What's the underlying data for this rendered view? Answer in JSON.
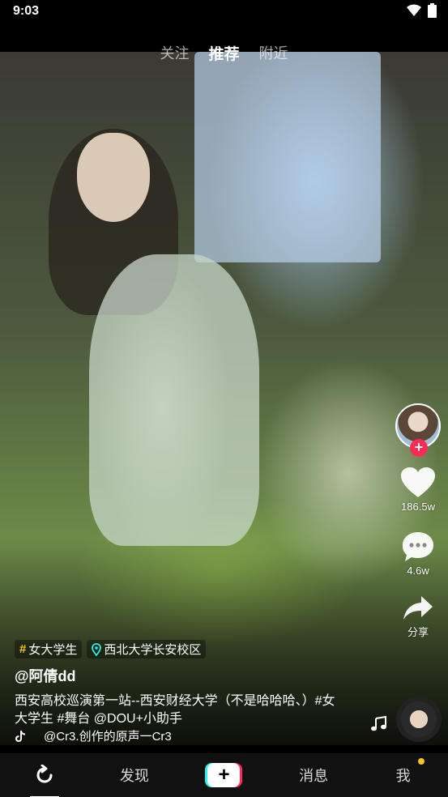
{
  "status_bar": {
    "time": "9:03"
  },
  "top_tabs": [
    {
      "label": "关注",
      "active": false
    },
    {
      "label": "推荐",
      "active": true
    },
    {
      "label": "附近",
      "active": false
    }
  ],
  "side_actions": {
    "like_count": "186.5w",
    "comment_count": "4.6w",
    "share_label": "分享"
  },
  "video_info": {
    "tags": [
      "女大学生",
      "西北大学长安校区"
    ],
    "author": "@阿倩dd",
    "description": "西安高校巡演第一站--西安财经大学（不是哈哈哈、）#女大学生 #舞台 @DOU+小助手",
    "music": "@Cr3.创作的原声一Cr3"
  },
  "bottom_nav": {
    "home_icon": "refresh-icon",
    "discover": "发现",
    "messages": "消息",
    "me": "我"
  },
  "colors": {
    "accent": "#fe2c55",
    "cyan": "#25f4ee",
    "tag_yellow": "#f5c518"
  }
}
